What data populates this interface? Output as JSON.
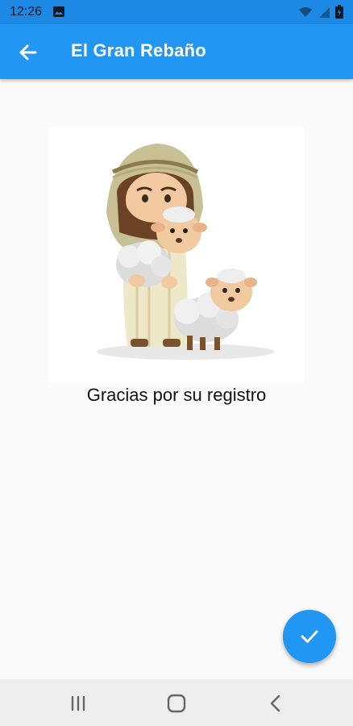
{
  "status_bar": {
    "time": "12:26",
    "icons": [
      "image-icon",
      "wifi-icon",
      "signal-icon",
      "battery-icon"
    ]
  },
  "app_bar": {
    "title": "El Gran Rebaño",
    "back_icon": "arrow-back-icon",
    "color": "#2196f3"
  },
  "main": {
    "message": "Gracias por su registro"
  },
  "fab": {
    "icon": "check-icon",
    "color": "#2196f3"
  },
  "nav_bar": {
    "buttons": [
      "recent-apps-icon",
      "home-icon",
      "back-icon"
    ]
  }
}
